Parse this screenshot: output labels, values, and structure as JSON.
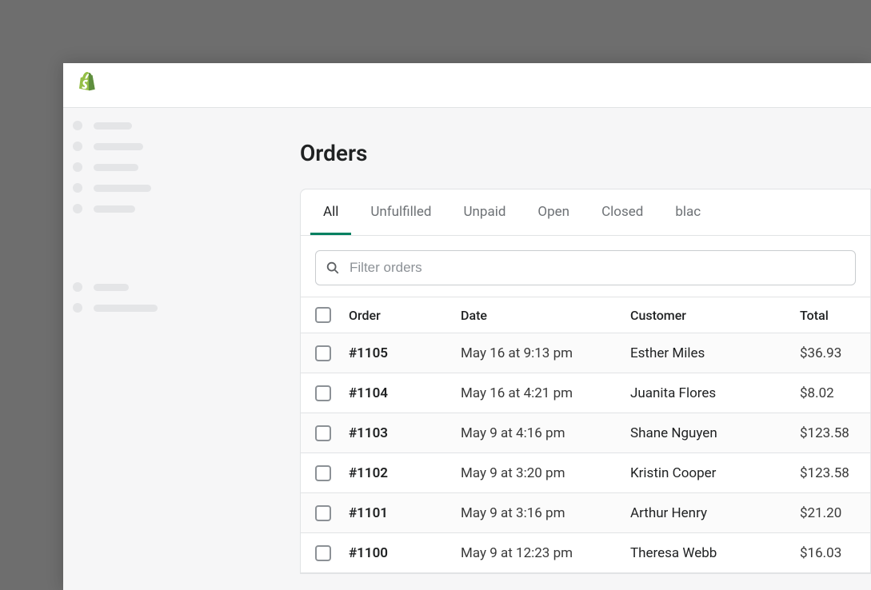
{
  "page": {
    "title": "Orders"
  },
  "tabs": [
    {
      "label": "All",
      "active": true
    },
    {
      "label": "Unfulfilled",
      "active": false
    },
    {
      "label": "Unpaid",
      "active": false
    },
    {
      "label": "Open",
      "active": false
    },
    {
      "label": "Closed",
      "active": false
    },
    {
      "label": "blac",
      "active": false
    }
  ],
  "filter": {
    "placeholder": "Filter orders"
  },
  "columns": {
    "order": "Order",
    "date": "Date",
    "customer": "Customer",
    "total": "Total"
  },
  "orders": [
    {
      "id": "#1105",
      "date": "May 16 at 9:13 pm",
      "customer": "Esther Miles",
      "total": "$36.93"
    },
    {
      "id": "#1104",
      "date": "May 16 at 4:21 pm",
      "customer": "Juanita Flores",
      "total": "$8.02"
    },
    {
      "id": "#1103",
      "date": "May 9 at 4:16 pm",
      "customer": "Shane Nguyen",
      "total": "$123.58"
    },
    {
      "id": "#1102",
      "date": "May 9 at 3:20 pm",
      "customer": "Kristin Cooper",
      "total": "$123.58"
    },
    {
      "id": "#1101",
      "date": "May 9 at 3:16 pm",
      "customer": "Arthur Henry",
      "total": "$21.20"
    },
    {
      "id": "#1100",
      "date": "May 9 at 12:23 pm",
      "customer": "Theresa Webb",
      "total": "$16.03"
    }
  ],
  "sidebar_skeleton": {
    "group1_widths": [
      48,
      62,
      56,
      72,
      52
    ],
    "group2_widths": [
      44,
      80
    ]
  }
}
